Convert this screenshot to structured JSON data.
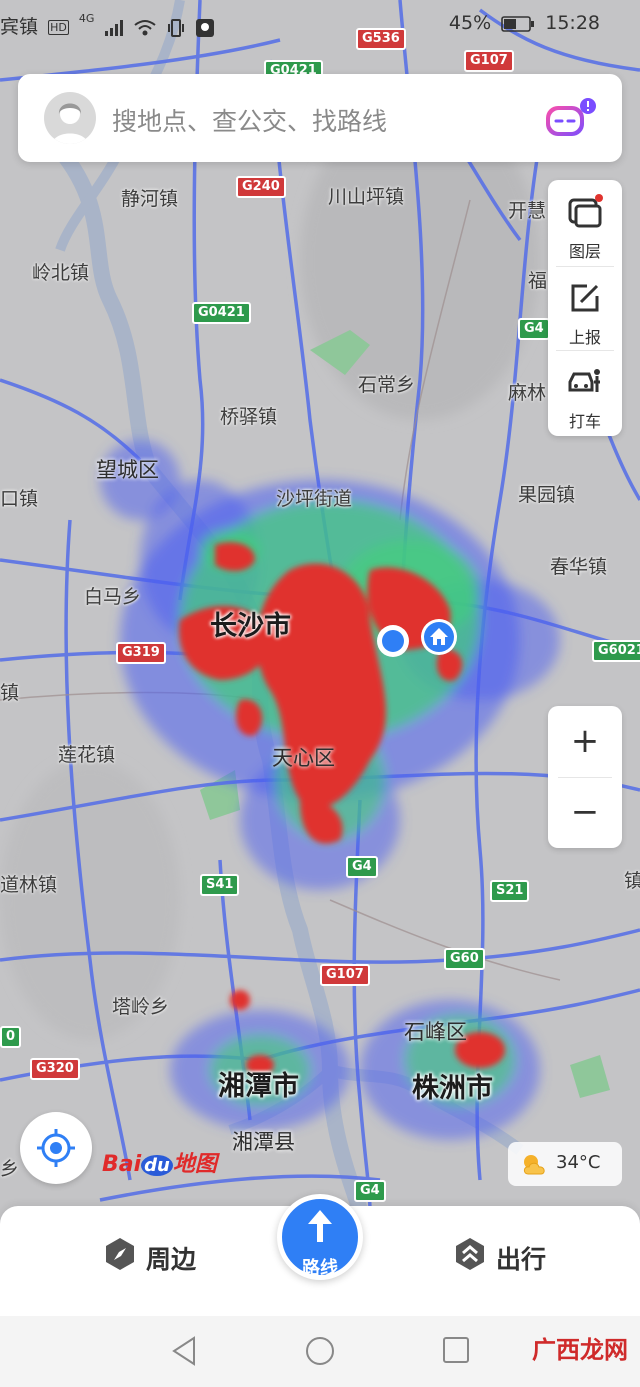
{
  "status_bar": {
    "carrier_fragment": "宾镇",
    "hd": "HD",
    "net": "4G",
    "battery": "45%",
    "time": "15:28"
  },
  "search": {
    "placeholder": "搜地点、查公交、找路线"
  },
  "tools": [
    {
      "label": "图层",
      "icon": "layers-icon"
    },
    {
      "label": "上报",
      "icon": "report-edit-icon"
    },
    {
      "label": "打车",
      "icon": "taxi-icon"
    }
  ],
  "zoom": {
    "in": "+",
    "out": "−"
  },
  "map": {
    "cities": [
      "长沙市",
      "湘潭市",
      "株洲市"
    ],
    "districts": [
      "天心区",
      "望城区",
      "石峰区",
      "湘潭县"
    ],
    "places": [
      "静河镇",
      "川山坪镇",
      "开慧",
      "岭北镇",
      "福",
      "石常乡",
      "麻林",
      "桥驿镇",
      "沙坪街道",
      "果园镇",
      "白马乡",
      "春华镇",
      "莲花镇",
      "塔岭乡",
      "道林镇",
      "口镇",
      "镇",
      "乡",
      "镇"
    ],
    "road_shields": [
      {
        "label": "G536",
        "color": "red"
      },
      {
        "label": "G0421",
        "color": "green"
      },
      {
        "label": "G107",
        "color": "red"
      },
      {
        "label": "G240",
        "color": "red"
      },
      {
        "label": "G0421",
        "color": "green"
      },
      {
        "label": "G4",
        "color": "green"
      },
      {
        "label": "G319",
        "color": "red"
      },
      {
        "label": "G6021",
        "color": "green"
      },
      {
        "label": "G4",
        "color": "green"
      },
      {
        "label": "S41",
        "color": "green"
      },
      {
        "label": "S21",
        "color": "green"
      },
      {
        "label": "G60",
        "color": "green"
      },
      {
        "label": "G107",
        "color": "red"
      },
      {
        "label": "G320",
        "color": "red"
      },
      {
        "label": "G4",
        "color": "green"
      },
      {
        "label": "0",
        "color": "green"
      }
    ]
  },
  "logo": {
    "part1": "Bai",
    "part2": "du",
    "part3": "地图"
  },
  "weather": {
    "temp": "34°C",
    "icon": "partly-cloudy-icon"
  },
  "bottom_bar": {
    "nearby": "周边",
    "route": "路线",
    "travel": "出行"
  },
  "watermark": "广西龙网",
  "colors": {
    "accent": "#2f7ff5",
    "heat_red": "#e0332e",
    "road_blue": "#5a72e6"
  }
}
